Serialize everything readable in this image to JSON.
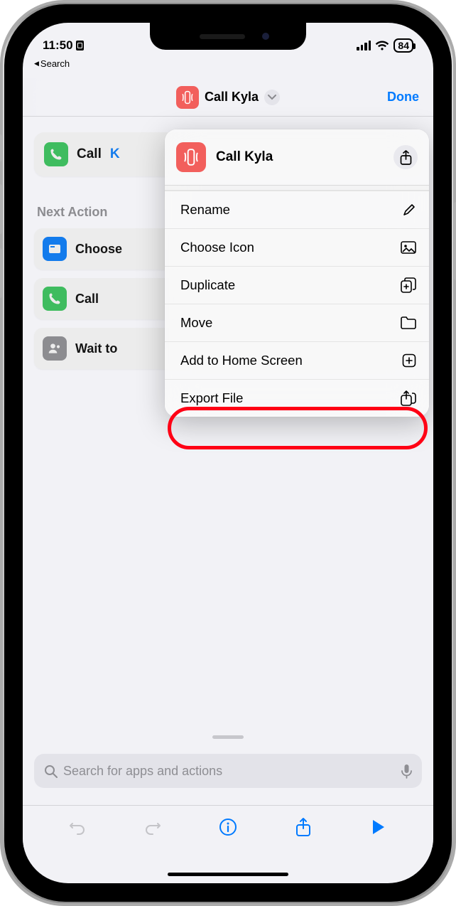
{
  "status": {
    "time": "11:50",
    "battery": "84"
  },
  "back_link": "Search",
  "nav": {
    "title": "Call Kyla",
    "done": "Done"
  },
  "main_action": {
    "verb": "Call",
    "param": "K"
  },
  "suggestions": {
    "heading": "Next Action",
    "items": [
      "Choose",
      "Call",
      "Wait to"
    ]
  },
  "popover": {
    "title": "Call Kyla",
    "items": [
      {
        "label": "Rename",
        "icon": "pencil"
      },
      {
        "label": "Choose Icon",
        "icon": "image"
      },
      {
        "label": "Duplicate",
        "icon": "duplicate"
      },
      {
        "label": "Move",
        "icon": "folder"
      },
      {
        "label": "Add to Home Screen",
        "icon": "add-home"
      },
      {
        "label": "Export File",
        "icon": "export"
      }
    ]
  },
  "search": {
    "placeholder": "Search for apps and actions"
  },
  "highlight": "Add to Home Screen",
  "colors": {
    "accent": "#007aff",
    "shortcut_red": "#f25f5c",
    "green": "#34c759",
    "ring": "#ff0015"
  }
}
